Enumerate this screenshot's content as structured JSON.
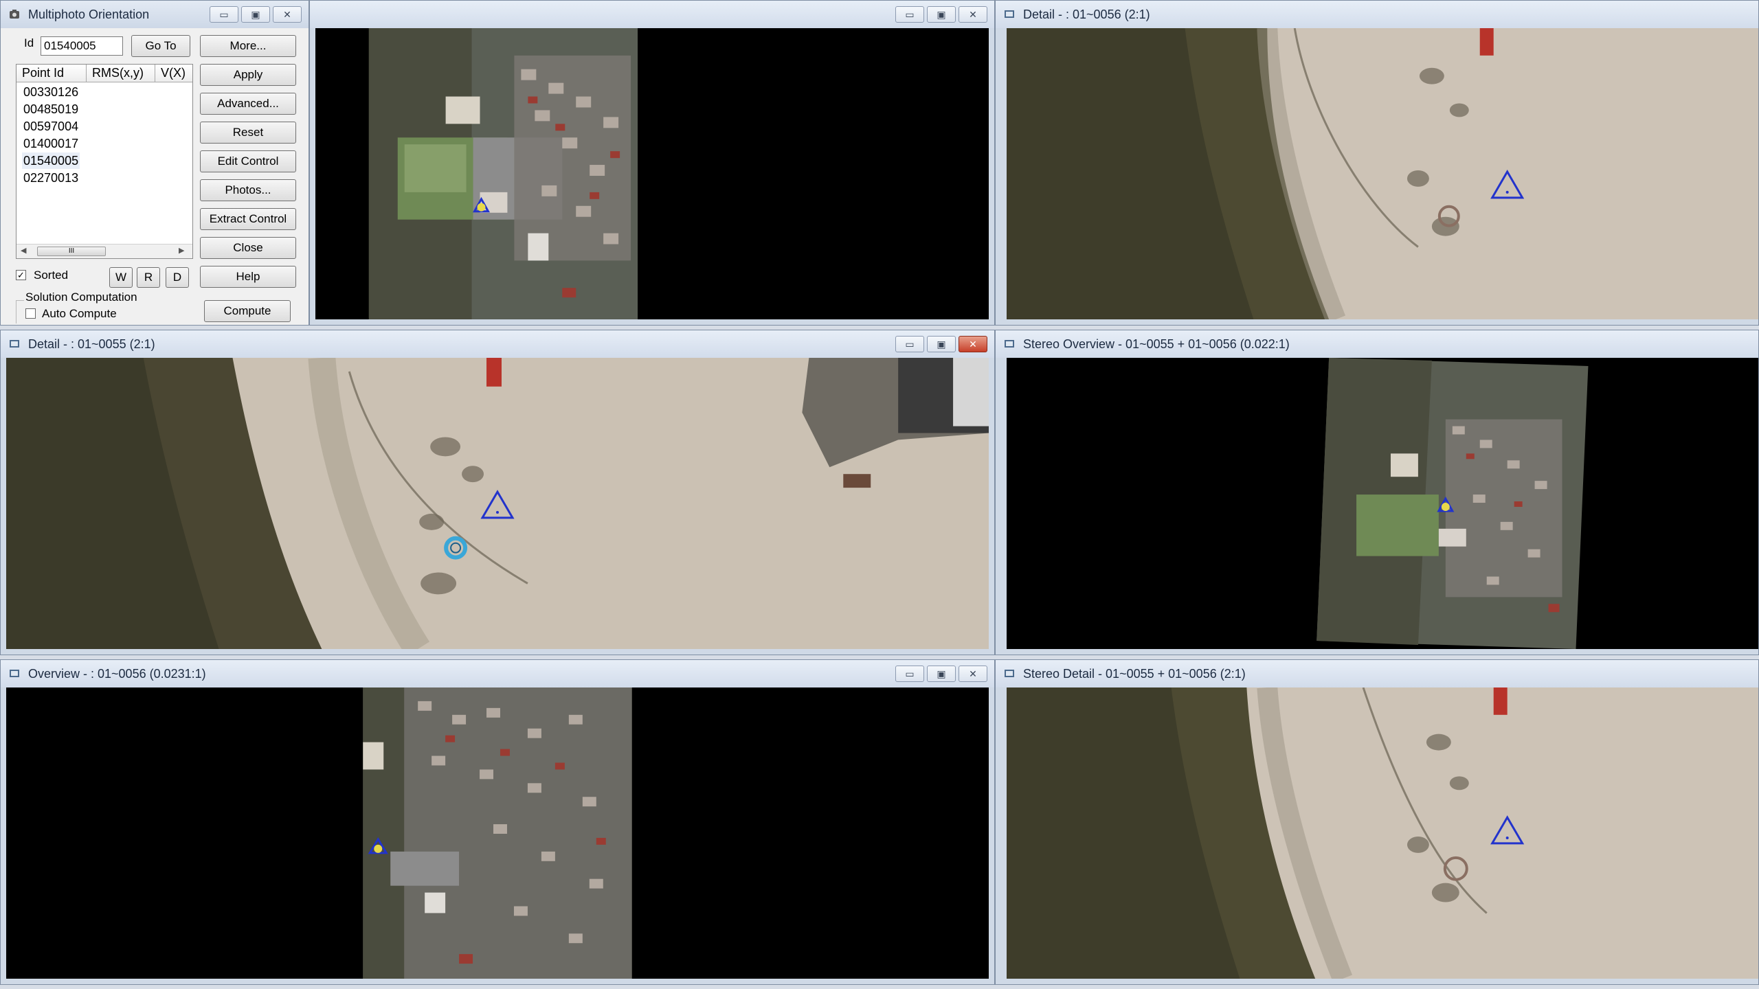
{
  "dialog": {
    "title": "Multiphoto Orientation",
    "id_label": "Id",
    "id_value": "01540005",
    "goto_label": "Go To",
    "buttons": [
      "More...",
      "Apply",
      "Advanced...",
      "Reset",
      "Edit Control",
      "Photos...",
      "Extract Control",
      "Close",
      "Help"
    ],
    "columns": [
      "Point Id",
      "RMS(x,y)",
      "V(X)"
    ],
    "rows": [
      "00330126",
      "00485019",
      "00597004",
      "01400017",
      "01540005",
      "02270013"
    ],
    "selected_row": "01540005",
    "scroll_thumb_glyph": "III",
    "sorted_label": "Sorted",
    "sorted_checked": true,
    "wrd_buttons": [
      "W",
      "R",
      "D"
    ],
    "group_label": "Solution Computation",
    "auto_compute_label": "Auto Compute",
    "auto_compute_checked": false,
    "compute_label": "Compute"
  },
  "windows": {
    "overview_top": {
      "title": ""
    },
    "detail_56_top": {
      "title": "Detail -  : 01~0056  (2:1)"
    },
    "detail_55": {
      "title": "Detail -  : 01~0055  (2:1)"
    },
    "stereo_overview": {
      "title": "Stereo Overview - 01~0055 + 01~0056  (0.022:1)"
    },
    "overview_56": {
      "title": "Overview -  : 01~0056  (0.0231:1)"
    },
    "stereo_detail": {
      "title": "Stereo Detail - 01~0055 + 01~0056  (2:1)"
    }
  },
  "window_controls": {
    "minimize": "▭",
    "maximize": "▣",
    "close": "✕"
  },
  "colors": {
    "marker": "#2233cc",
    "marker_fill": "#e8d94a",
    "highlight_ring": "#3aa7d8"
  },
  "icons": [
    "window-icon",
    "control-point-triangle-icon",
    "measured-point-ring-icon",
    "minimize-icon",
    "maximize-icon",
    "close-icon"
  ]
}
